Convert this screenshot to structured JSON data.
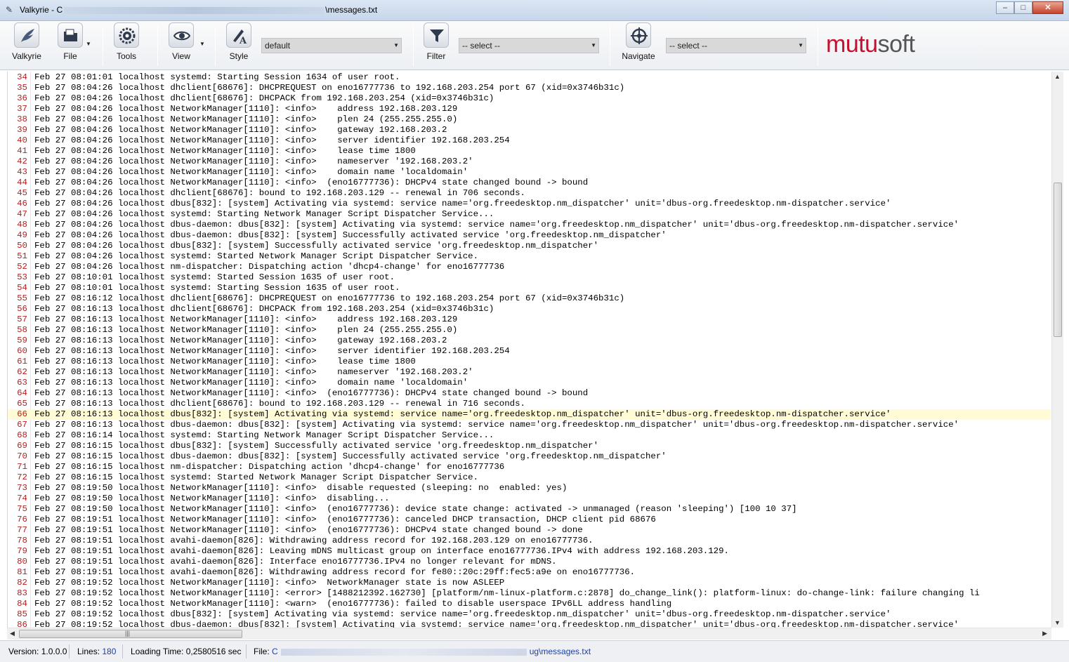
{
  "window": {
    "title_prefix": "Valkyrie - C",
    "title_suffix": "\\messages.txt",
    "minimize": "–",
    "maximize": "□",
    "close": "✕"
  },
  "toolbar": {
    "valkyrie_label": "Valkyrie",
    "file_label": "File",
    "tools_label": "Tools",
    "view_label": "View",
    "style_label": "Style",
    "style_value": "default",
    "filter_label": "Filter",
    "filter_value": "-- select --",
    "navigate_label": "Navigate",
    "navigate_value": "-- select --",
    "logo_part1": "mutu",
    "logo_part2": "soft"
  },
  "log": {
    "current_line": 66,
    "lines": [
      {
        "n": "34",
        "t": "Feb 27 08:01:01 localhost systemd: Starting Session 1634 of user root."
      },
      {
        "n": "35",
        "t": "Feb 27 08:04:26 localhost dhclient[68676]: DHCPREQUEST on eno16777736 to 192.168.203.254 port 67 (xid=0x3746b31c)"
      },
      {
        "n": "36",
        "t": "Feb 27 08:04:26 localhost dhclient[68676]: DHCPACK from 192.168.203.254 (xid=0x3746b31c)"
      },
      {
        "n": "37",
        "t": "Feb 27 08:04:26 localhost NetworkManager[1110]: <info>    address 192.168.203.129"
      },
      {
        "n": "38",
        "t": "Feb 27 08:04:26 localhost NetworkManager[1110]: <info>    plen 24 (255.255.255.0)"
      },
      {
        "n": "39",
        "t": "Feb 27 08:04:26 localhost NetworkManager[1110]: <info>    gateway 192.168.203.2"
      },
      {
        "n": "40",
        "t": "Feb 27 08:04:26 localhost NetworkManager[1110]: <info>    server identifier 192.168.203.254"
      },
      {
        "n": "41",
        "t": "Feb 27 08:04:26 localhost NetworkManager[1110]: <info>    lease time 1800"
      },
      {
        "n": "42",
        "t": "Feb 27 08:04:26 localhost NetworkManager[1110]: <info>    nameserver '192.168.203.2'"
      },
      {
        "n": "43",
        "t": "Feb 27 08:04:26 localhost NetworkManager[1110]: <info>    domain name 'localdomain'"
      },
      {
        "n": "44",
        "t": "Feb 27 08:04:26 localhost NetworkManager[1110]: <info>  (eno16777736): DHCPv4 state changed bound -> bound"
      },
      {
        "n": "45",
        "t": "Feb 27 08:04:26 localhost dhclient[68676]: bound to 192.168.203.129 -- renewal in 706 seconds."
      },
      {
        "n": "46",
        "t": "Feb 27 08:04:26 localhost dbus[832]: [system] Activating via systemd: service name='org.freedesktop.nm_dispatcher' unit='dbus-org.freedesktop.nm-dispatcher.service'"
      },
      {
        "n": "47",
        "t": "Feb 27 08:04:26 localhost systemd: Starting Network Manager Script Dispatcher Service..."
      },
      {
        "n": "48",
        "t": "Feb 27 08:04:26 localhost dbus-daemon: dbus[832]: [system] Activating via systemd: service name='org.freedesktop.nm_dispatcher' unit='dbus-org.freedesktop.nm-dispatcher.service'"
      },
      {
        "n": "49",
        "t": "Feb 27 08:04:26 localhost dbus-daemon: dbus[832]: [system] Successfully activated service 'org.freedesktop.nm_dispatcher'"
      },
      {
        "n": "50",
        "t": "Feb 27 08:04:26 localhost dbus[832]: [system] Successfully activated service 'org.freedesktop.nm_dispatcher'"
      },
      {
        "n": "51",
        "t": "Feb 27 08:04:26 localhost systemd: Started Network Manager Script Dispatcher Service."
      },
      {
        "n": "52",
        "t": "Feb 27 08:04:26 localhost nm-dispatcher: Dispatching action 'dhcp4-change' for eno16777736"
      },
      {
        "n": "53",
        "t": "Feb 27 08:10:01 localhost systemd: Started Session 1635 of user root."
      },
      {
        "n": "54",
        "t": "Feb 27 08:10:01 localhost systemd: Starting Session 1635 of user root."
      },
      {
        "n": "55",
        "t": "Feb 27 08:16:12 localhost dhclient[68676]: DHCPREQUEST on eno16777736 to 192.168.203.254 port 67 (xid=0x3746b31c)"
      },
      {
        "n": "56",
        "t": "Feb 27 08:16:13 localhost dhclient[68676]: DHCPACK from 192.168.203.254 (xid=0x3746b31c)"
      },
      {
        "n": "57",
        "t": "Feb 27 08:16:13 localhost NetworkManager[1110]: <info>    address 192.168.203.129"
      },
      {
        "n": "58",
        "t": "Feb 27 08:16:13 localhost NetworkManager[1110]: <info>    plen 24 (255.255.255.0)"
      },
      {
        "n": "59",
        "t": "Feb 27 08:16:13 localhost NetworkManager[1110]: <info>    gateway 192.168.203.2"
      },
      {
        "n": "60",
        "t": "Feb 27 08:16:13 localhost NetworkManager[1110]: <info>    server identifier 192.168.203.254"
      },
      {
        "n": "61",
        "t": "Feb 27 08:16:13 localhost NetworkManager[1110]: <info>    lease time 1800"
      },
      {
        "n": "62",
        "t": "Feb 27 08:16:13 localhost NetworkManager[1110]: <info>    nameserver '192.168.203.2'"
      },
      {
        "n": "63",
        "t": "Feb 27 08:16:13 localhost NetworkManager[1110]: <info>    domain name 'localdomain'"
      },
      {
        "n": "64",
        "t": "Feb 27 08:16:13 localhost NetworkManager[1110]: <info>  (eno16777736): DHCPv4 state changed bound -> bound"
      },
      {
        "n": "65",
        "t": "Feb 27 08:16:13 localhost dhclient[68676]: bound to 192.168.203.129 -- renewal in 716 seconds."
      },
      {
        "n": "66",
        "t": "Feb 27 08:16:13 localhost dbus[832]: [system] Activating via systemd: service name='org.freedesktop.nm_dispatcher' unit='dbus-org.freedesktop.nm-dispatcher.service'"
      },
      {
        "n": "67",
        "t": "Feb 27 08:16:13 localhost dbus-daemon: dbus[832]: [system] Activating via systemd: service name='org.freedesktop.nm_dispatcher' unit='dbus-org.freedesktop.nm-dispatcher.service'"
      },
      {
        "n": "68",
        "t": "Feb 27 08:16:14 localhost systemd: Starting Network Manager Script Dispatcher Service..."
      },
      {
        "n": "69",
        "t": "Feb 27 08:16:15 localhost dbus[832]: [system] Successfully activated service 'org.freedesktop.nm_dispatcher'"
      },
      {
        "n": "70",
        "t": "Feb 27 08:16:15 localhost dbus-daemon: dbus[832]: [system] Successfully activated service 'org.freedesktop.nm_dispatcher'"
      },
      {
        "n": "71",
        "t": "Feb 27 08:16:15 localhost nm-dispatcher: Dispatching action 'dhcp4-change' for eno16777736"
      },
      {
        "n": "72",
        "t": "Feb 27 08:16:15 localhost systemd: Started Network Manager Script Dispatcher Service."
      },
      {
        "n": "73",
        "t": "Feb 27 08:19:50 localhost NetworkManager[1110]: <info>  disable requested (sleeping: no  enabled: yes)"
      },
      {
        "n": "74",
        "t": "Feb 27 08:19:50 localhost NetworkManager[1110]: <info>  disabling..."
      },
      {
        "n": "75",
        "t": "Feb 27 08:19:50 localhost NetworkManager[1110]: <info>  (eno16777736): device state change: activated -> unmanaged (reason 'sleeping') [100 10 37]"
      },
      {
        "n": "76",
        "t": "Feb 27 08:19:51 localhost NetworkManager[1110]: <info>  (eno16777736): canceled DHCP transaction, DHCP client pid 68676"
      },
      {
        "n": "77",
        "t": "Feb 27 08:19:51 localhost NetworkManager[1110]: <info>  (eno16777736): DHCPv4 state changed bound -> done"
      },
      {
        "n": "78",
        "t": "Feb 27 08:19:51 localhost avahi-daemon[826]: Withdrawing address record for 192.168.203.129 on eno16777736."
      },
      {
        "n": "79",
        "t": "Feb 27 08:19:51 localhost avahi-daemon[826]: Leaving mDNS multicast group on interface eno16777736.IPv4 with address 192.168.203.129."
      },
      {
        "n": "80",
        "t": "Feb 27 08:19:51 localhost avahi-daemon[826]: Interface eno16777736.IPv4 no longer relevant for mDNS."
      },
      {
        "n": "81",
        "t": "Feb 27 08:19:51 localhost avahi-daemon[826]: Withdrawing address record for fe80::20c:29ff:fec5:a9e on eno16777736."
      },
      {
        "n": "82",
        "t": "Feb 27 08:19:52 localhost NetworkManager[1110]: <info>  NetworkManager state is now ASLEEP"
      },
      {
        "n": "83",
        "t": "Feb 27 08:19:52 localhost NetworkManager[1110]: <error> [1488212392.162730] [platform/nm-linux-platform.c:2878] do_change_link(): platform-linux: do-change-link: failure changing li"
      },
      {
        "n": "84",
        "t": "Feb 27 08:19:52 localhost NetworkManager[1110]: <warn>  (eno16777736): failed to disable userspace IPv6LL address handling"
      },
      {
        "n": "85",
        "t": "Feb 27 08:19:52 localhost dbus[832]: [system] Activating via systemd: service name='org.freedesktop.nm_dispatcher' unit='dbus-org.freedesktop.nm-dispatcher.service'"
      },
      {
        "n": "86",
        "t": "Feb 27 08:19:52 localhost dbus-daemon: dbus[832]: [system] Activating via systemd: service name='org.freedesktop.nm_dispatcher' unit='dbus-org.freedesktop.nm-dispatcher.service'"
      }
    ]
  },
  "status": {
    "version_label": "Version:",
    "version_value": "1.0.0.0",
    "lines_label": "Lines:",
    "lines_value": "180",
    "loading_label": "Loading Time:",
    "loading_value": "0,2580516 sec",
    "file_label": "File:",
    "file_prefix": "C",
    "file_suffix": "ug\\messages.txt"
  },
  "colors": {
    "line_number": "#b72020",
    "current_line_bg": "#fffbd4",
    "logo_red": "#c8102e",
    "status_value": "#1a3fb0"
  },
  "icons": {
    "app": "feather-icon",
    "valkyrie": "wing-icon",
    "file": "folder-icon",
    "tools": "gear-icon",
    "view": "eye-icon",
    "style": "pen-font-icon",
    "filter": "funnel-icon",
    "navigate": "crosshair-icon"
  }
}
